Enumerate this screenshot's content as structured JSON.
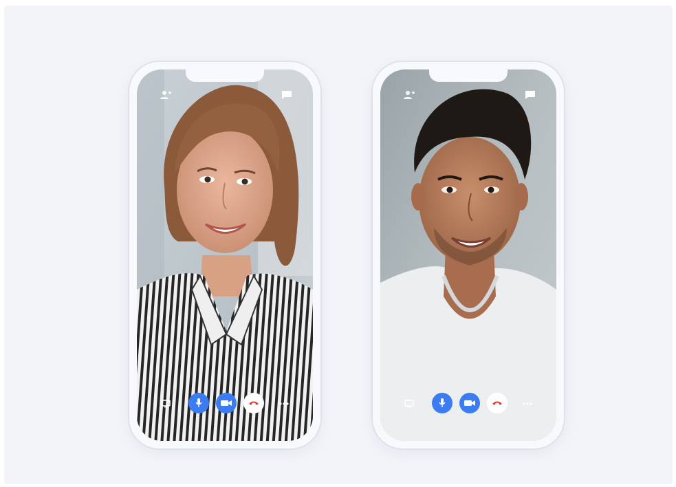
{
  "scene": {
    "background": "#f2f4f8",
    "accent": "#3b7cf0",
    "end_call_color": "#e53935"
  },
  "phones": [
    {
      "id": "left",
      "participant": "woman-in-striped-shirt",
      "controls": [
        "share-screen-icon",
        "mic-icon",
        "video-camera-icon",
        "end-call-icon",
        "more-icon"
      ],
      "top_icons": [
        "add-person-icon",
        "chat-icon"
      ]
    },
    {
      "id": "right",
      "participant": "man-in-white-shirt",
      "controls": [
        "share-screen-icon",
        "mic-icon",
        "video-camera-icon",
        "end-call-icon",
        "more-icon"
      ],
      "top_icons": [
        "add-person-icon",
        "chat-icon"
      ]
    }
  ]
}
